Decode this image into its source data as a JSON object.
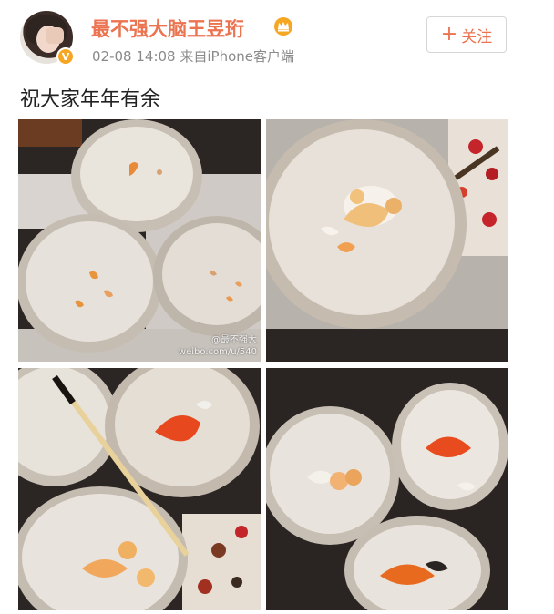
{
  "post": {
    "username": "最不强大脑王昱珩",
    "timestamp": "02-08 14:08",
    "source": "来自iPhone客户端",
    "follow_label": "关注",
    "text": "祝大家年年有余",
    "verified_icon": "verified-badge-icon",
    "member_icon": "crown-icon"
  },
  "photos": [
    {
      "description_icon": "goldfish-plates-photo",
      "watermark_line1": "@最不强大",
      "watermark_line2": "weibo.com/u/540"
    },
    {
      "description_icon": "goldfish-plate-closeup-photo"
    },
    {
      "description_icon": "goldfish-painting-brush-photo"
    },
    {
      "description_icon": "goldfish-plates-three-photo"
    }
  ],
  "colors": {
    "username": "#eb7350",
    "meta": "#8a8a8a",
    "badge": "#f5a623"
  }
}
